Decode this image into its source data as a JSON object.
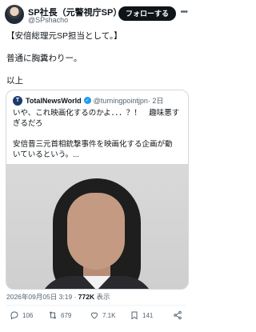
{
  "author": {
    "name": "SP社長（元警視庁SP）",
    "handle": "@SPshacho",
    "follow_label": "フォローする"
  },
  "tweet": {
    "line1": "【安倍総理元SP担当として。】",
    "line2": "普通に胸糞わりー。",
    "line3": "以上"
  },
  "quote": {
    "avatar_letter": "T",
    "name": "TotalNewsWorld",
    "handle": "@turningpointjpn",
    "time": "· 2日",
    "text1": "いや、これ映画化するのかよ．．．？！　趣味悪すぎるだろ",
    "text2": "安倍晋三元首相銃撃事件を映画化する企画が動いているという。..."
  },
  "meta": {
    "datetime": "2026年09月05日 3:19 · ",
    "views": "772K",
    "views_label": " 表示"
  },
  "actions": {
    "replies": "106",
    "reposts": "679",
    "likes": "7.1K",
    "bookmarks": "141"
  }
}
